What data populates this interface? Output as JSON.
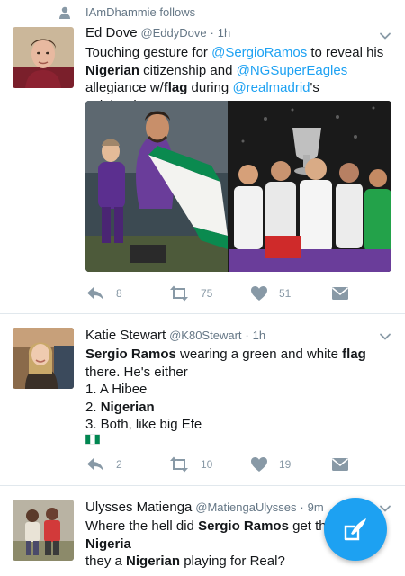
{
  "social_context": {
    "text": "IAmDhammie follows",
    "icon": "person-icon"
  },
  "tweets": [
    {
      "name": "Ed Dove",
      "handle": "@EddyDove",
      "separator": "·",
      "time": "1h",
      "text_parts": [
        {
          "t": "Touching gesture for ",
          "k": "plain"
        },
        {
          "t": "@SergioRamos",
          "k": "mention"
        },
        {
          "t": " to reveal his ",
          "k": "plain"
        },
        {
          "t": "Nigerian",
          "k": "bold"
        },
        {
          "t": " citizenship and ",
          "k": "plain"
        },
        {
          "t": "@NGSuperEagles",
          "k": "mention"
        },
        {
          "t": " allegiance w/",
          "k": "plain"
        },
        {
          "t": "flag",
          "k": "bold"
        },
        {
          "t": " during ",
          "k": "plain"
        },
        {
          "t": "@realmadrid",
          "k": "mention"
        },
        {
          "t": "'s celebrations!",
          "k": "plain"
        }
      ],
      "actions": {
        "reply": "8",
        "retweet": "75",
        "like": "51"
      }
    },
    {
      "name": "Katie Stewart",
      "handle": "@K80Stewart",
      "separator": "·",
      "time": "1h",
      "text_parts": [
        {
          "t": "Sergio Ramos",
          "k": "bold"
        },
        {
          "t": " wearing a green and white ",
          "k": "plain"
        },
        {
          "t": "flag",
          "k": "bold"
        },
        {
          "t": " there. He's either",
          "k": "plain"
        },
        {
          "t": "\n1. A Hibee",
          "k": "plain"
        },
        {
          "t": "\n2. ",
          "k": "plain"
        },
        {
          "t": "Nigerian",
          "k": "bold"
        },
        {
          "t": "\n3. Both, like big Efe",
          "k": "plain"
        }
      ],
      "actions": {
        "reply": "2",
        "retweet": "10",
        "like": "19"
      }
    },
    {
      "name": "Ulysses Matienga",
      "handle": "@MatiengaUlysses",
      "separator": "·",
      "time": "9m",
      "text_parts": [
        {
          "t": "Where the hell did ",
          "k": "plain"
        },
        {
          "t": "Sergio Ramos",
          "k": "bold"
        },
        {
          "t": " get that ",
          "k": "plain"
        },
        {
          "t": "Nigeria",
          "k": "bold"
        },
        {
          "t": "\nthey a ",
          "k": "plain"
        },
        {
          "t": "Nigerian",
          "k": "bold"
        },
        {
          "t": " playing for Real?",
          "k": "plain"
        }
      ]
    }
  ],
  "colors": {
    "accent": "#1da1f2",
    "secondary_text": "#657786",
    "icon_gray": "#8899a6",
    "divider": "#e1e8ed",
    "nigeria_green": "#008751"
  },
  "fab": {
    "icon": "compose-tweet-icon"
  }
}
